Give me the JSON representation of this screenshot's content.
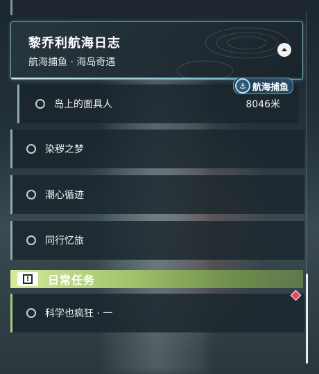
{
  "quest_group": {
    "title": "黎乔利航海日志",
    "subtitle": "航海捕鱼 · 海岛奇遇",
    "tag": "航海捕鱼",
    "tag_icon": "anchor-icon",
    "expanded": true
  },
  "sub_quest": {
    "label": "岛上的面具人",
    "distance": "8046米"
  },
  "quests": [
    {
      "label": "染秽之梦"
    },
    {
      "label": "潮心循迹"
    },
    {
      "label": "同行忆旅"
    }
  ],
  "daily": {
    "header": "日常任务",
    "icon": "exclamation-icon",
    "items": [
      {
        "label": "科学也疯狂 · 一"
      }
    ]
  },
  "colors": {
    "daily_accent": "#a3c46c",
    "quest_border": "#7aa7b4",
    "marker": "#e04a5a"
  }
}
